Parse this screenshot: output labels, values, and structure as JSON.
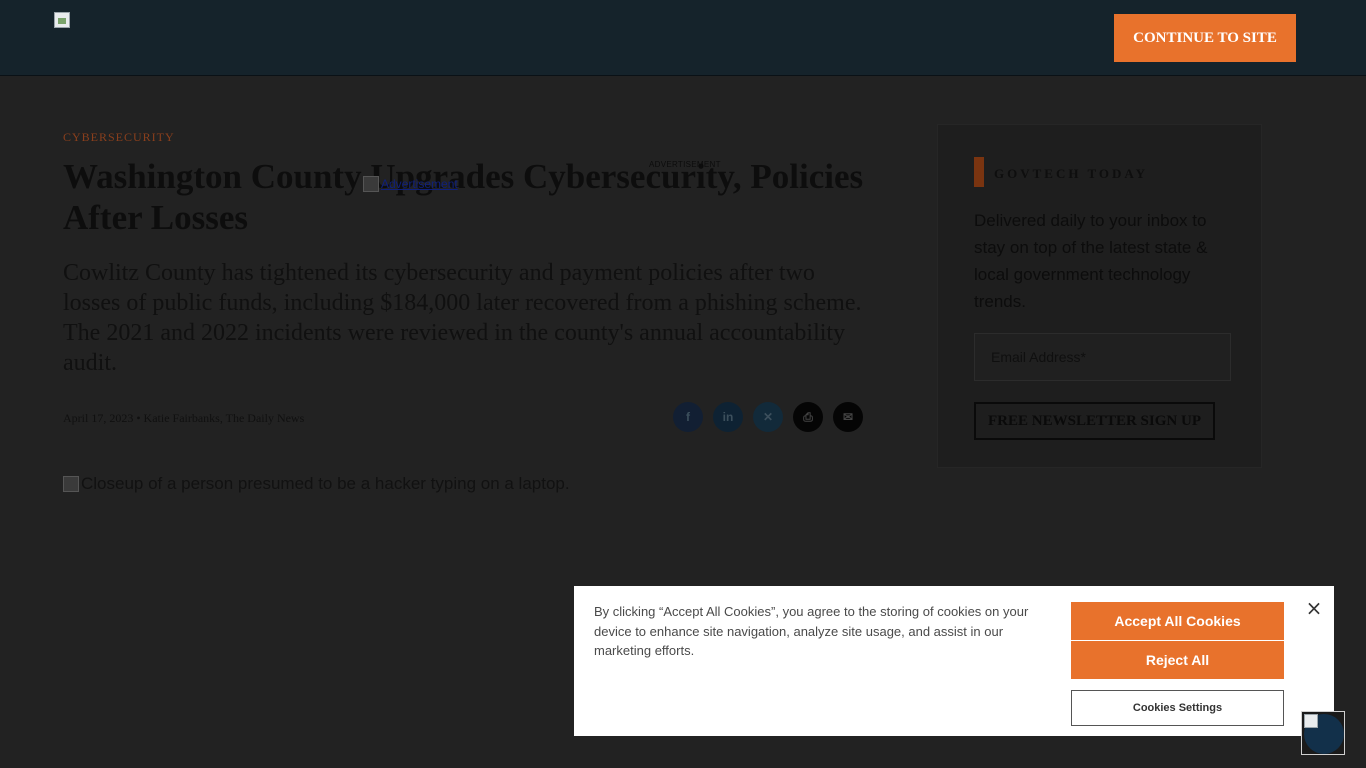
{
  "header": {
    "continue_label": "CONTINUE TO SITE"
  },
  "article": {
    "category": "CYBERSECURITY",
    "headline": "Washington County Upgrades Cybersecurity, Policies After Losses",
    "dek": "Cowlitz County has tightened its cybersecurity and payment policies after two losses of public funds, including $184,000 later recovered from a phishing scheme. The 2021 and 2022 incidents were reviewed in the county's annual accountability audit.",
    "byline": "April 17, 2023 • Katie Fairbanks, The Daily News",
    "hero_alt": "Closeup of a person presumed to be a hacker typing on a laptop."
  },
  "share": [
    {
      "icon": "facebook-icon",
      "glyph": "f"
    },
    {
      "icon": "linkedin-icon",
      "glyph": "in"
    },
    {
      "icon": "x-icon",
      "glyph": "✕"
    },
    {
      "icon": "print-icon",
      "glyph": "⎙"
    },
    {
      "icon": "email-icon",
      "glyph": "✉"
    }
  ],
  "ad": {
    "label": "ADVERTISEMENT",
    "link_text": "Advertisement"
  },
  "sidebar": {
    "title": "GOVTECH TODAY",
    "description": "Delivered daily to your inbox to stay on top of the latest state & local government technology trends.",
    "email_placeholder": "Email Address*",
    "signup_label": "FREE NEWSLETTER SIGN UP"
  },
  "cookie_banner": {
    "text": "By clicking “Accept All Cookies”, you agree to the storing of cookies on your device to enhance site navigation, analyze site usage, and assist in our marketing efforts.",
    "accept_label": "Accept All Cookies",
    "reject_label": "Reject All",
    "settings_label": "Cookies Settings",
    "close_glyph": "×"
  },
  "colors": {
    "accent": "#e8722c",
    "header_bg": "#15232b",
    "page_overlay": "#222222"
  }
}
